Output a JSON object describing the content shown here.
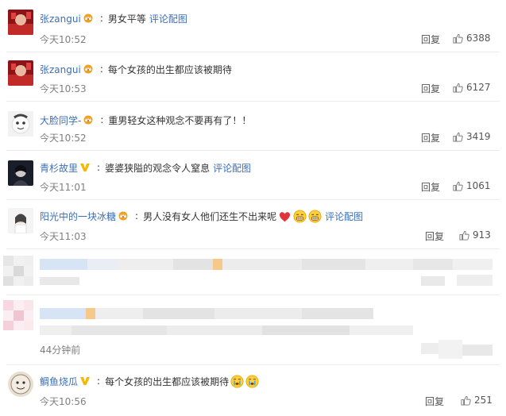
{
  "actions": {
    "reply_label": "回复"
  },
  "comments": [
    {
      "username": "张zangui",
      "badge": "crown",
      "text": "男女平等",
      "link": "评论配图",
      "time": "今天10:52",
      "likes": "6388"
    },
    {
      "username": "张zangui",
      "badge": "crown",
      "text": "每个女孩的出生都应该被期待",
      "link": "",
      "time": "今天10:53",
      "likes": "6127"
    },
    {
      "username": "大脸同学-",
      "badge": "crown",
      "text": "重男轻女这种观念不要再有了！！",
      "link": "",
      "time": "今天10:52",
      "likes": "3419"
    },
    {
      "username": "青杉故里",
      "badge": "verified-v",
      "text": "婆婆狭隘的观念令人窒息",
      "link": "评论配图",
      "time": "今天11:01",
      "likes": "1061"
    },
    {
      "username": "阳光中的一块冰糖",
      "badge": "crown",
      "text": "男人没有女人他们还生不出来呢",
      "emojis": [
        "heart",
        "grin",
        "grin"
      ],
      "link": "评论配图",
      "time": "今天11:03",
      "likes": "913"
    },
    {
      "username": "",
      "text": "",
      "time": "",
      "likes": "",
      "blurred": true
    },
    {
      "username": "",
      "text": "",
      "time": "44分钟前",
      "likes": "",
      "blurred": true
    },
    {
      "username": "鲷鱼烧瓜",
      "badge": "verified-v",
      "text": "每个女孩的出生都应该被期待",
      "emojis": [
        "cry",
        "cry"
      ],
      "link": "",
      "time": "今天10:56",
      "likes": "251"
    }
  ],
  "colors": {
    "link": "#3b6fb7",
    "muted": "#808080",
    "crown": "#f0a020",
    "vbadge": "#f5b800",
    "heart": "#e0333a"
  }
}
